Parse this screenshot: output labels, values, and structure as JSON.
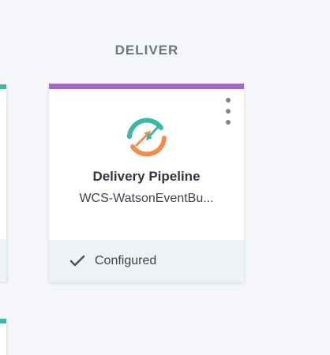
{
  "section": {
    "title": "DELIVER"
  },
  "card": {
    "title": "Delivery Pipeline",
    "subtitle": "WCS-WatsonEventBu...",
    "status": "Configured",
    "icon": "delivery-pipeline-icon",
    "menu_icon": "kebab-menu-icon",
    "status_icon": "checkmark-icon"
  },
  "colors": {
    "background": "#f4f6f9",
    "deliver_accent": "#9e68c4",
    "neighbor_accent": "#3ab8a5",
    "icon_teal": "#3ab8a5",
    "icon_orange": "#f28c4a",
    "footer": "#eef2f6",
    "text_dark": "#2f3742",
    "text_muted": "#6f7680"
  }
}
